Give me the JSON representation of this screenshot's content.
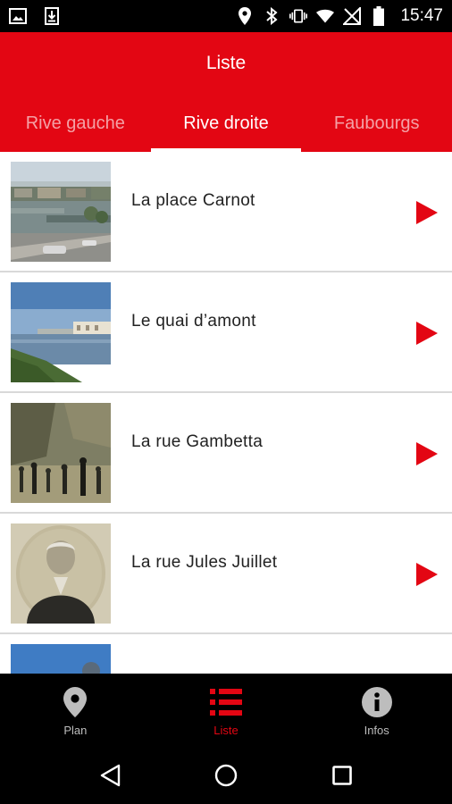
{
  "status_bar": {
    "time": "15:47",
    "icons_left": [
      "image-icon",
      "download-icon"
    ],
    "icons_right": [
      "location-icon",
      "bluetooth-icon",
      "vibrate-icon",
      "wifi-icon",
      "no-signal-icon",
      "battery-icon"
    ]
  },
  "header": {
    "title": "Liste",
    "tabs": [
      {
        "label": "Rive gauche",
        "active": false
      },
      {
        "label": "Rive droite",
        "active": true
      },
      {
        "label": "Faubourgs",
        "active": false
      }
    ]
  },
  "list": {
    "items": [
      {
        "title": "La place Carnot",
        "thumbnail": "harbor-photo"
      },
      {
        "title": "Le quai d’amont",
        "thumbnail": "river-photo"
      },
      {
        "title": "La rue Gambetta",
        "thumbnail": "painting-photo"
      },
      {
        "title": "La rue Jules Juillet",
        "thumbnail": "portrait-photo"
      },
      {
        "title": "",
        "thumbnail": "sky-photo"
      }
    ]
  },
  "bottom_nav": {
    "items": [
      {
        "label": "Plan",
        "icon": "map-pin-icon",
        "active": false
      },
      {
        "label": "Liste",
        "icon": "list-icon",
        "active": true
      },
      {
        "label": "Infos",
        "icon": "info-icon",
        "active": false
      }
    ]
  },
  "colors": {
    "accent": "#e30613",
    "status_bar": "#000000",
    "nav_inactive": "#bdbdbd"
  }
}
